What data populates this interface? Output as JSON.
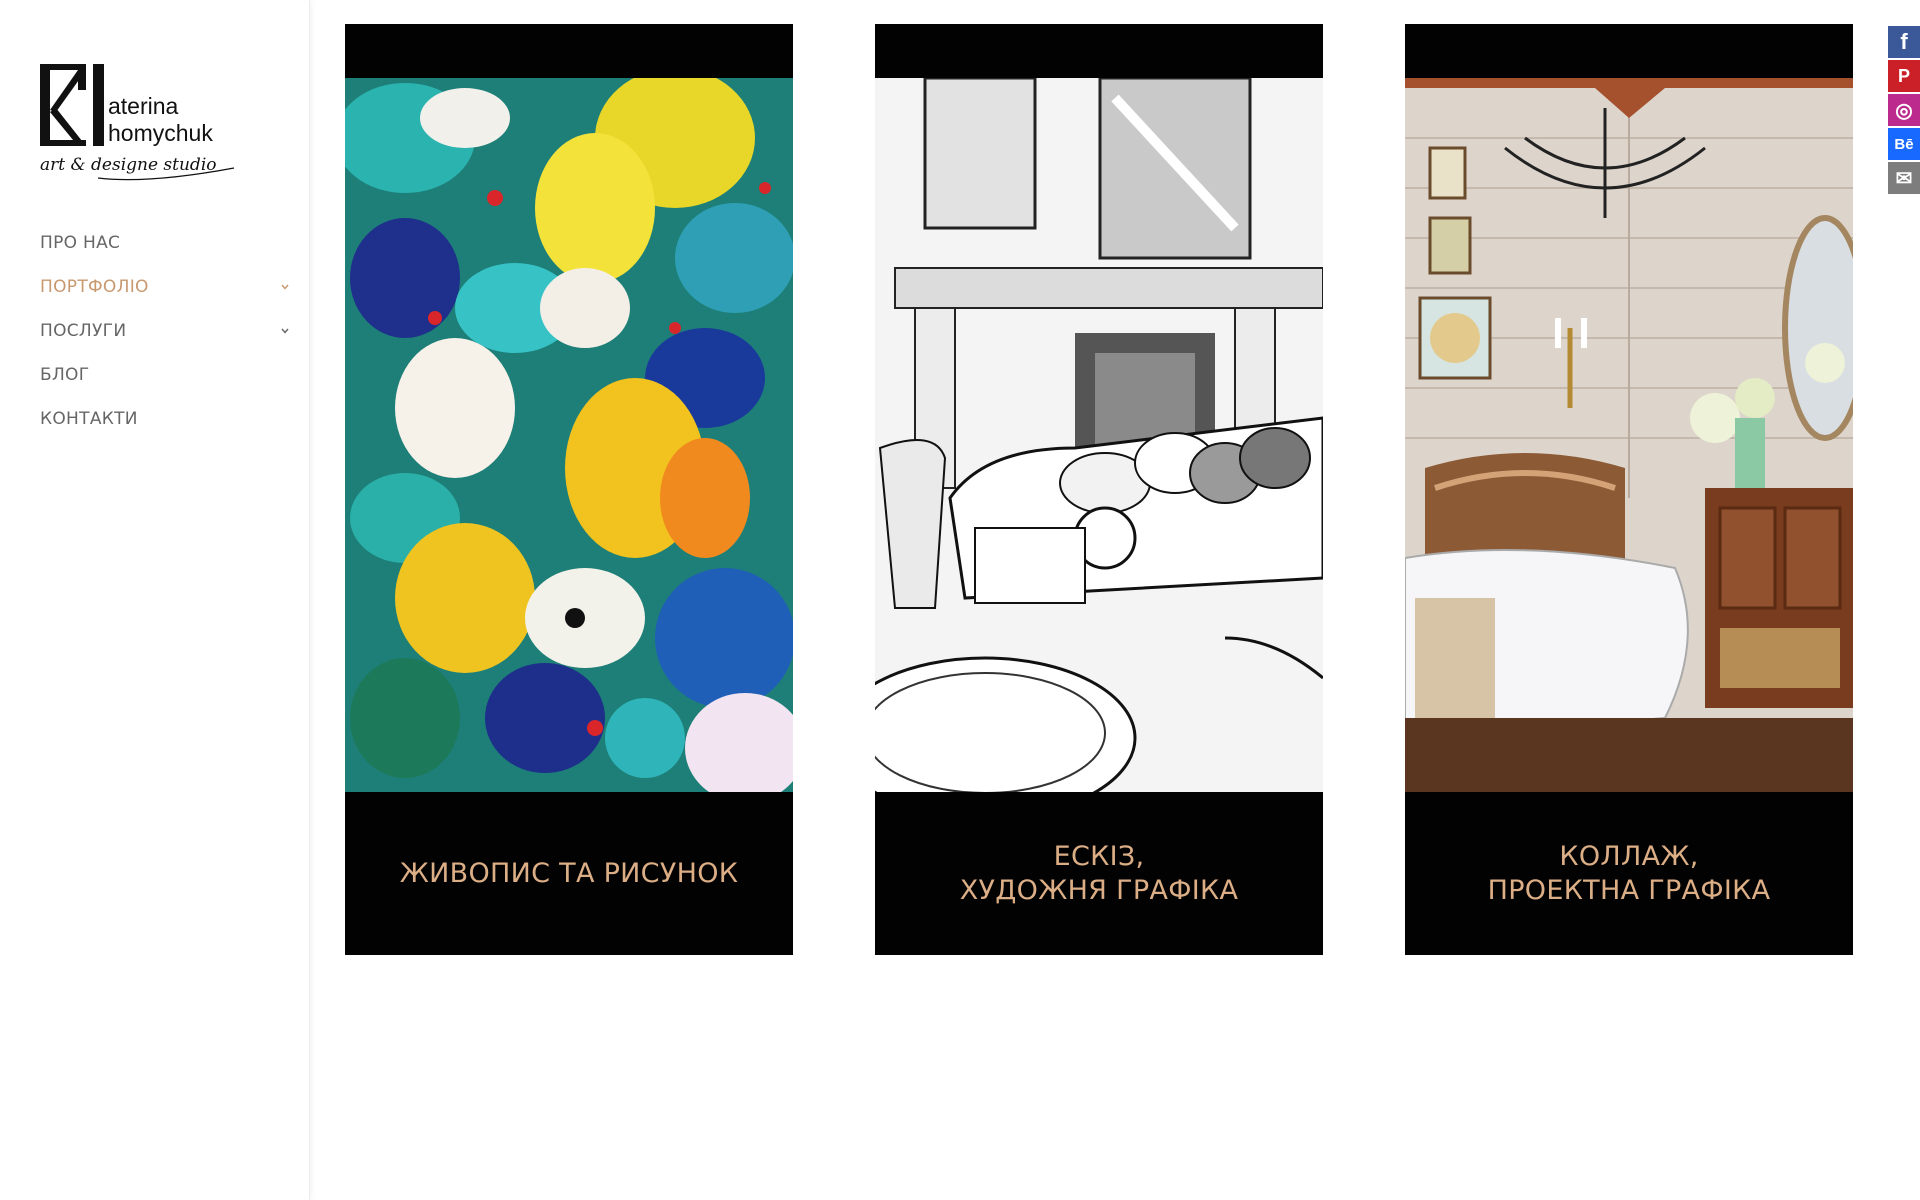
{
  "logo": {
    "mark": "K",
    "line1": "aterina",
    "line2": "homychuk",
    "tagline": "art & designe studio"
  },
  "nav": {
    "items": [
      {
        "label": "ПРО НАС",
        "has_submenu": false,
        "active": false
      },
      {
        "label": "ПОРТФОЛІО",
        "has_submenu": true,
        "active": true
      },
      {
        "label": "ПОСЛУГИ",
        "has_submenu": true,
        "active": false
      },
      {
        "label": "БЛОГ",
        "has_submenu": false,
        "active": false
      },
      {
        "label": "КОНТАКТИ",
        "has_submenu": false,
        "active": false
      }
    ]
  },
  "portfolio": [
    {
      "line1": "ЖИВОПИС ТА РИСУНОК",
      "line2": "",
      "image": "painting-flowers-image"
    },
    {
      "line1": "ЕСКІЗ,",
      "line2": "ХУДОЖНЯ ГРАФІКА",
      "image": "sketch-interior-image"
    },
    {
      "line1": "КОЛЛАЖ,",
      "line2": "ПРОЕКТНА ГРАФІКА",
      "image": "collage-bathroom-image"
    }
  ],
  "social": [
    {
      "icon": "facebook-icon",
      "glyph": "f",
      "color": "#3b5998"
    },
    {
      "icon": "pinterest-icon",
      "glyph": "P",
      "color": "#cb2027"
    },
    {
      "icon": "instagram-icon",
      "glyph": "◎",
      "color": "#bc2a8d"
    },
    {
      "icon": "behance-icon",
      "glyph": "Bē",
      "color": "#1769ff"
    },
    {
      "icon": "email-icon",
      "glyph": "✉",
      "color": "#7d7d7d"
    }
  ],
  "colors": {
    "accent": "#c8986f",
    "caption": "#dcae86",
    "nav": "#666666",
    "card_bg": "#030203"
  }
}
